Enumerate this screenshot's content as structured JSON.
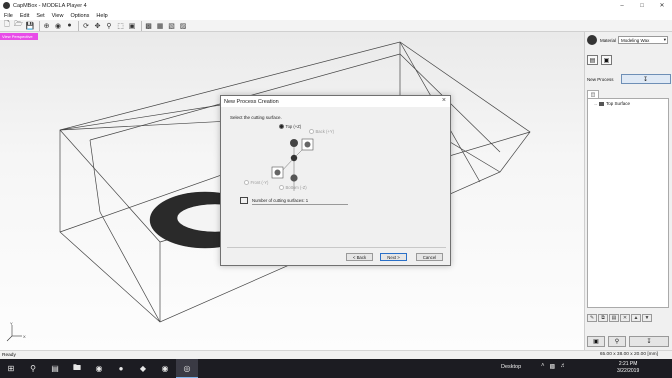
{
  "window": {
    "title": "CapMBox - MODELA Player 4",
    "controls": [
      "–",
      "□",
      "✕"
    ]
  },
  "menu": [
    "File",
    "Edit",
    "Set",
    "View",
    "Options",
    "Help"
  ],
  "toolbar_icons": [
    "new-file",
    "open-folder",
    "save",
    "top-view",
    "globe-view",
    "sphere-view",
    "rotate",
    "move",
    "zoom",
    "zoom-fit",
    "zoom-window",
    "cube-solid",
    "cube-front",
    "cube-side",
    "cube-iso"
  ],
  "viewport": {
    "tag": "View  Perspective"
  },
  "dialog": {
    "title": "New Process Creation",
    "prompt": "Select the cutting surface.",
    "options": {
      "top": "Top (+Z)",
      "back": "Back (+Y)",
      "front": "Front (-Y)",
      "bottom": "Bottom (-Z)"
    },
    "count_label": "Number of cutting surfaces: 1",
    "buttons": {
      "back": "< Back",
      "next": "Next >",
      "cancel": "Cancel"
    }
  },
  "panel": {
    "material_label": "Material",
    "material_value": "Modeling Wax",
    "new_process_label": "New Process",
    "tree_item": "Top Surface"
  },
  "status": {
    "left": "Ready",
    "dims": "65.00 x 38.00 x 20.00 [mm]"
  },
  "taskbar": {
    "desktop": "Desktop",
    "time": "2:21 PM",
    "date": "3/22/2019"
  }
}
